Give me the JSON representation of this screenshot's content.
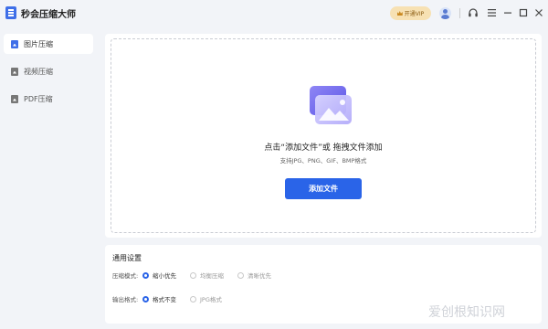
{
  "app": {
    "title": "秒会压缩大师",
    "vip_label": "开通VIP"
  },
  "titlebar": {
    "icons": [
      "avatar",
      "headset-icon",
      "menu-icon",
      "minimize-icon",
      "maximize-icon",
      "close-icon"
    ],
    "menu_glyph": "☰",
    "minimize_glyph": "—",
    "maximize_glyph": "☐",
    "close_glyph": "✕"
  },
  "sidebar": {
    "items": [
      {
        "label": "图片压缩",
        "icon": "image-icon",
        "active": true
      },
      {
        "label": "视频压缩",
        "icon": "video-icon",
        "active": false
      },
      {
        "label": "PDF压缩",
        "icon": "pdf-icon",
        "active": false
      }
    ]
  },
  "upload": {
    "drop_text": "点击“添加文件”或 拖拽文件添加",
    "format_text": "支持JPG、PNG、GIF、BMP格式",
    "add_button_label": "添加文件"
  },
  "settings": {
    "title": "通用设置",
    "compress_mode": {
      "label": "压缩模式:",
      "options": [
        "缩小优先",
        "均衡压缩",
        "清晰优先"
      ],
      "selected": "缩小优先"
    },
    "output_format": {
      "label": "输出格式:",
      "options": [
        "格式不变",
        "JPG格式"
      ],
      "selected": "格式不变"
    }
  },
  "colors": {
    "accent": "#2a64e8",
    "vip_bg": "#f7e1b3",
    "background": "#f2f4f8"
  },
  "watermark": "爱创根知识网"
}
